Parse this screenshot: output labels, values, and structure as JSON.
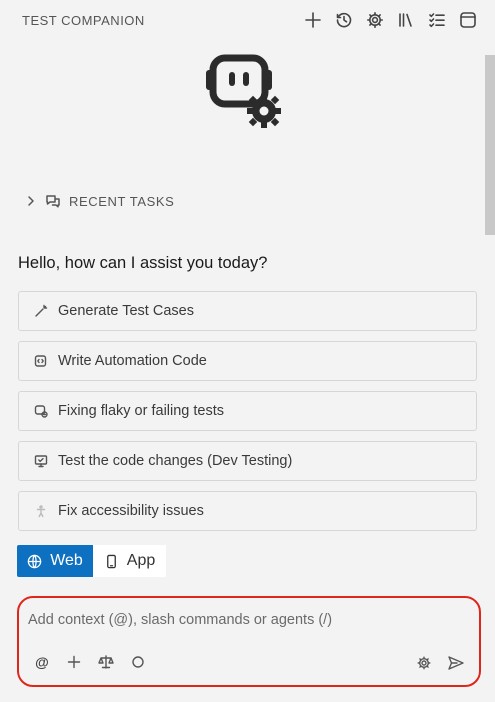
{
  "header": {
    "title": "TEST COMPANION",
    "actions": [
      "plus-icon",
      "history-icon",
      "gear-icon",
      "library-icon",
      "checklist-icon",
      "panel-icon"
    ]
  },
  "recent": {
    "label": "RECENT TASKS"
  },
  "greeting": "Hello, how can I assist you today?",
  "suggestions": [
    {
      "label": "Generate Test Cases",
      "icon": "wand-icon"
    },
    {
      "label": "Write Automation Code",
      "icon": "code-edit-icon"
    },
    {
      "label": "Fixing flaky or failing tests",
      "icon": "bug-fix-icon"
    },
    {
      "label": "Test the code changes (Dev Testing)",
      "icon": "monitor-check-icon"
    },
    {
      "label": "Fix accessibility issues",
      "icon": "accessibility-icon"
    }
  ],
  "mode": {
    "web_label": "Web",
    "app_label": "App",
    "selected": "Web"
  },
  "composer": {
    "placeholder": "Add context (@), slash commands or agents (/)",
    "value": "",
    "at_label": "@"
  },
  "colors": {
    "accent": "#0e70c0",
    "focus_border": "#e0261c",
    "background": "#f3f3f3"
  }
}
